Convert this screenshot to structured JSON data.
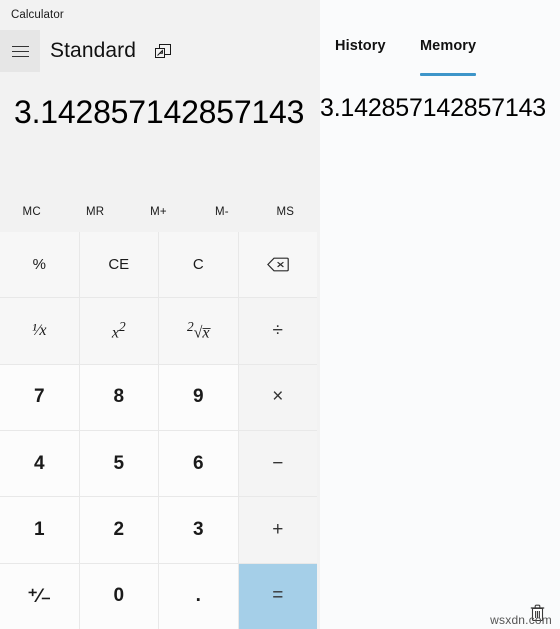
{
  "window": {
    "title": "Calculator",
    "controls": [
      {
        "name": "minimize",
        "label": "—"
      },
      {
        "name": "maximize",
        "label": "□"
      },
      {
        "name": "close",
        "label": "✕"
      }
    ]
  },
  "header": {
    "menu_icon": "hamburger-icon",
    "mode": "Standard",
    "keep_on_top_icon": "keep-on-top-icon"
  },
  "display": {
    "value": "3.142857142857143"
  },
  "memory_row": [
    {
      "label": "MC",
      "name": "memory-clear"
    },
    {
      "label": "MR",
      "name": "memory-recall"
    },
    {
      "label": "M+",
      "name": "memory-add"
    },
    {
      "label": "M-",
      "name": "memory-subtract"
    },
    {
      "label": "MS",
      "name": "memory-store"
    }
  ],
  "keypad": [
    {
      "label": "%",
      "name": "percent-button",
      "kind": "func"
    },
    {
      "label": "CE",
      "name": "clear-entry-button",
      "kind": "func"
    },
    {
      "label": "C",
      "name": "clear-button",
      "kind": "func"
    },
    {
      "label": "",
      "name": "backspace-button",
      "kind": "func",
      "icon": "backspace-icon"
    },
    {
      "label": "⅒x",
      "name": "reciprocal-button",
      "kind": "func",
      "math": true,
      "html": "¹⁄<i>x</i>"
    },
    {
      "label": "x²",
      "name": "square-button",
      "kind": "func",
      "math": true,
      "html": "<i>x</i><sup>2</sup>"
    },
    {
      "label": "²√x",
      "name": "square-root-button",
      "kind": "func",
      "math": true,
      "html": "<sup>2</sup>√<i>x̅</i>"
    },
    {
      "label": "÷",
      "name": "divide-button",
      "kind": "op",
      "glyph": true
    },
    {
      "label": "7",
      "name": "seven-button",
      "kind": "num"
    },
    {
      "label": "8",
      "name": "eight-button",
      "kind": "num"
    },
    {
      "label": "9",
      "name": "nine-button",
      "kind": "num"
    },
    {
      "label": "×",
      "name": "multiply-button",
      "kind": "op",
      "glyph": true
    },
    {
      "label": "4",
      "name": "four-button",
      "kind": "num"
    },
    {
      "label": "5",
      "name": "five-button",
      "kind": "num"
    },
    {
      "label": "6",
      "name": "six-button",
      "kind": "num"
    },
    {
      "label": "−",
      "name": "minus-button",
      "kind": "op",
      "glyph": true
    },
    {
      "label": "1",
      "name": "one-button",
      "kind": "num"
    },
    {
      "label": "2",
      "name": "two-button",
      "kind": "num"
    },
    {
      "label": "3",
      "name": "three-button",
      "kind": "num"
    },
    {
      "label": "+",
      "name": "plus-button",
      "kind": "op",
      "glyph": true
    },
    {
      "label": "⁺⁄₋",
      "name": "negate-button",
      "kind": "num",
      "html": "⁺⁄₋"
    },
    {
      "label": "0",
      "name": "zero-button",
      "kind": "num"
    },
    {
      "label": ".",
      "name": "decimal-button",
      "kind": "num"
    },
    {
      "label": "=",
      "name": "equals-button",
      "kind": "equals",
      "glyph": true
    }
  ],
  "side_panel": {
    "tabs": [
      {
        "label": "History",
        "name": "tab-history",
        "selected": false
      },
      {
        "label": "Memory",
        "name": "tab-memory",
        "selected": true
      }
    ],
    "memory_items": [
      {
        "value": "3.142857142857143"
      }
    ],
    "trash_icon": "trash-icon"
  },
  "watermark": {
    "text": "wsxdn.com"
  },
  "colors": {
    "accent": "#3d95c9",
    "equals_bg": "#a5cfe8",
    "window_bg": "#f2f2f2",
    "key_bg": "#fbfbfb"
  }
}
